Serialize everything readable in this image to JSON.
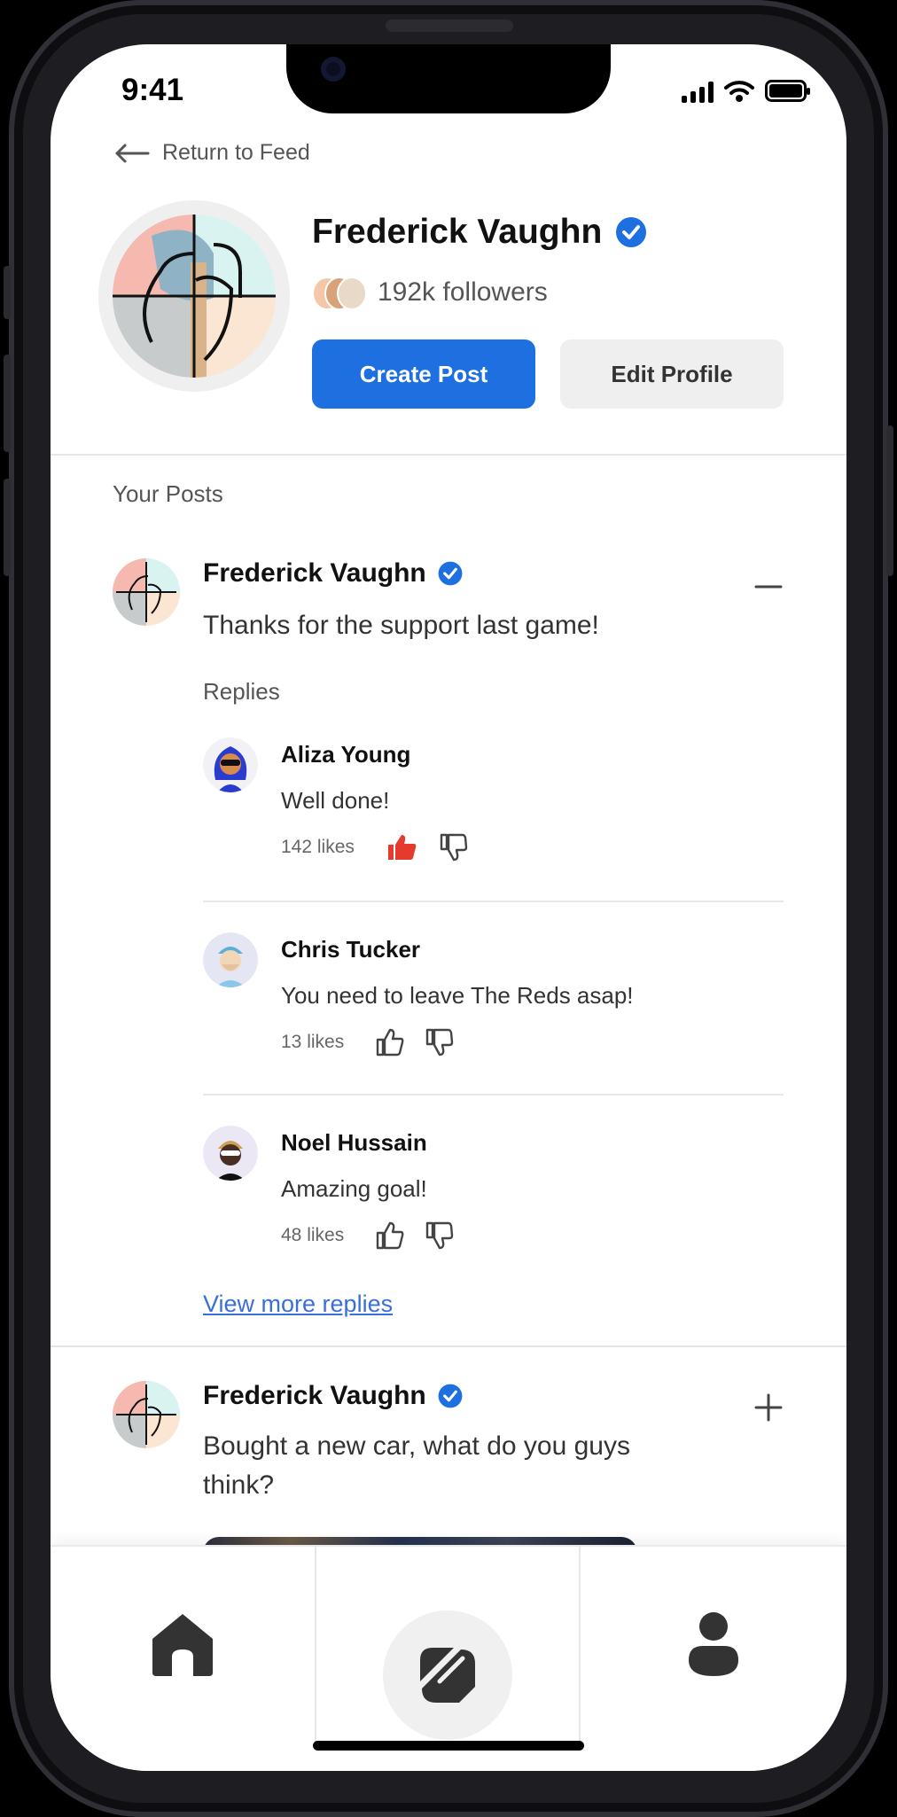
{
  "status_bar": {
    "time": "9:41"
  },
  "header": {
    "back_label": "Return to Feed"
  },
  "profile": {
    "name": "Frederick Vaughn",
    "followers": "192k followers",
    "create_post_label": "Create Post",
    "edit_profile_label": "Edit Profile"
  },
  "posts_section": {
    "title": "Your Posts"
  },
  "posts": [
    {
      "author": "Frederick Vaughn",
      "text": "Thanks for the support last game!",
      "replies_label": "Replies",
      "replies": [
        {
          "name": "Aliza Young",
          "text": "Well done!",
          "likes": "142 likes",
          "liked": true
        },
        {
          "name": "Chris Tucker",
          "text": "You need to leave The Reds asap!",
          "likes": "13 likes",
          "liked": false
        },
        {
          "name": "Noel Hussain",
          "text": "Amazing goal!",
          "likes": "48 likes",
          "liked": false
        }
      ],
      "view_more_label": "View more replies"
    },
    {
      "author": "Frederick Vaughn",
      "text": "Bought a new car, what do you guys think?"
    }
  ],
  "colors": {
    "primary": "#1e6fe0",
    "verified": "#1e6fe0",
    "like_active": "#e43b2c",
    "link": "#3a6fd8"
  }
}
